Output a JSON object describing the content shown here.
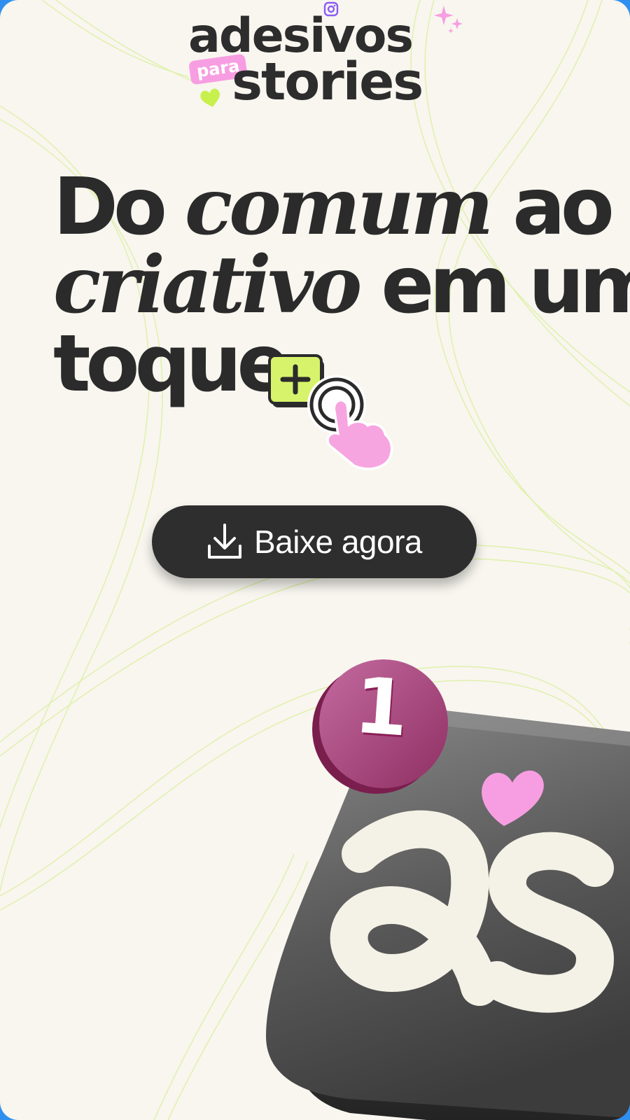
{
  "logo": {
    "word_top": "adesivos",
    "word_para": "para",
    "word_bottom": "stories",
    "icons": [
      "instagram-icon",
      "heart-icon",
      "sparkle-icon"
    ]
  },
  "headline": {
    "line1_a": "Do ",
    "line1_b": "comum",
    "line1_c": " ao",
    "line2_a": "criativo",
    "line2_b": " em um",
    "line3": "toque",
    "icons": [
      "plus-box-icon",
      "tap-hand-icon"
    ]
  },
  "cta": {
    "label": "Baixe agora",
    "icon": "download-icon"
  },
  "app_icon": {
    "badge_count": "1",
    "colors": {
      "badge": "#b24f85",
      "tile": "#4d4d4d",
      "heart": "#f79ee2",
      "accent_green": "#d7f36b"
    }
  },
  "colors": {
    "background": "#f8f6ef",
    "text": "#2b2b2b",
    "button": "#2e2e2e",
    "frame": "#2f8ff0"
  }
}
